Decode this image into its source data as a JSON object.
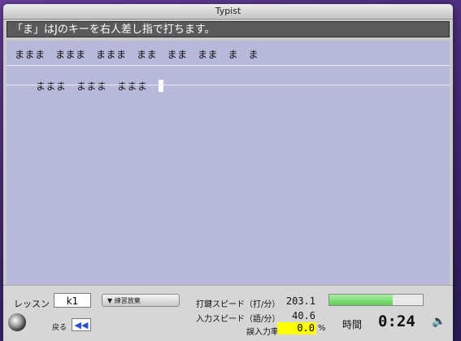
{
  "window": {
    "title": "Typist"
  },
  "instruction": "「ま」はJのキーを右人差し指で打ちます。",
  "typing": {
    "sample_text": "ままま　ままま　ままま　まま　まま　まま　ま　ま",
    "typed_text": "ままま　ままま　ままま"
  },
  "footer": {
    "lesson_label": "レッスン",
    "lesson_value": "k1",
    "practice_button": "▼ 練習放棄",
    "back_label": "戻る",
    "back_icon": "◀◀",
    "keystroke_speed_label": "打鍵スピード（打/分）",
    "keystroke_speed_value": "203.1",
    "input_speed_label": "入力スピード（語/分）",
    "input_speed_value": "40.6",
    "error_rate_label": "誤入力率",
    "error_rate_value": "0.0",
    "error_rate_unit": "%",
    "progress_fraction": 0.68,
    "time_label": "時間",
    "time_value": "0:24",
    "speaker_icon": "🔈"
  }
}
